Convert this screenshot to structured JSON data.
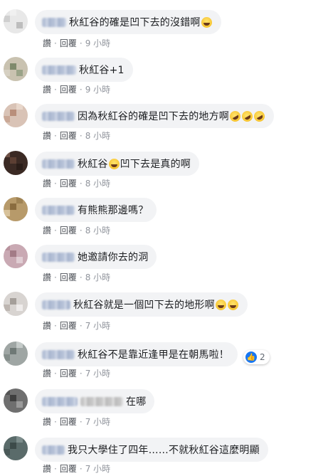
{
  "actions": {
    "reply": "回覆",
    "separator": "·"
  },
  "comments": [
    {
      "text_before": "秋紅谷的確是凹下去的沒錯啊",
      "emojis_after": [
        "laughing"
      ],
      "like_label": "讚",
      "time": "9 小時"
    },
    {
      "text_before": "秋紅谷+1",
      "emojis_after": [],
      "like_label": "讚",
      "time": "9 小時"
    },
    {
      "text_before": "因為秋紅谷的確是凹下去的地方啊",
      "emojis_after": [
        "rofl",
        "rofl",
        "rofl"
      ],
      "like_label": "讚",
      "time": "8 小時"
    },
    {
      "text_before": "秋紅谷",
      "emoji_mid": "laughing",
      "text_after": "凹下去是真的啊",
      "like_label": "讚",
      "time": "8 小時"
    },
    {
      "text_before": "有熊熊那邊嗎？",
      "emojis_after": [],
      "like_label": "讚",
      "time": "8 小時"
    },
    {
      "text_before": "她邀請你去的洞",
      "emojis_after": [],
      "like_label": "讚",
      "time": "8 小時"
    },
    {
      "text_before": "秋紅谷就是一個凹下去的地形啊",
      "emojis_after": [
        "laughing",
        "laughing"
      ],
      "like_label": "讚",
      "time": "7 小時"
    },
    {
      "text_before": "秋紅谷不是靠近逢甲是在朝馬啦！",
      "emojis_after": [],
      "like_label": "讚",
      "time": "7 小時",
      "reaction": {
        "icon": "like-icon",
        "count": "2"
      }
    },
    {
      "text_before": "在哪",
      "emojis_after": [],
      "like_label": "讚",
      "time": "7 小時"
    },
    {
      "text_before": "我只大學住了四年……不就秋紅谷這麼明顯",
      "emojis_after": [],
      "like_label": "讚",
      "time": "7 小時"
    }
  ],
  "colors": {
    "bubble": "#f2f3f5",
    "text": "#1c1e21",
    "meta": "#606770",
    "like_blue": "#1877f2"
  }
}
